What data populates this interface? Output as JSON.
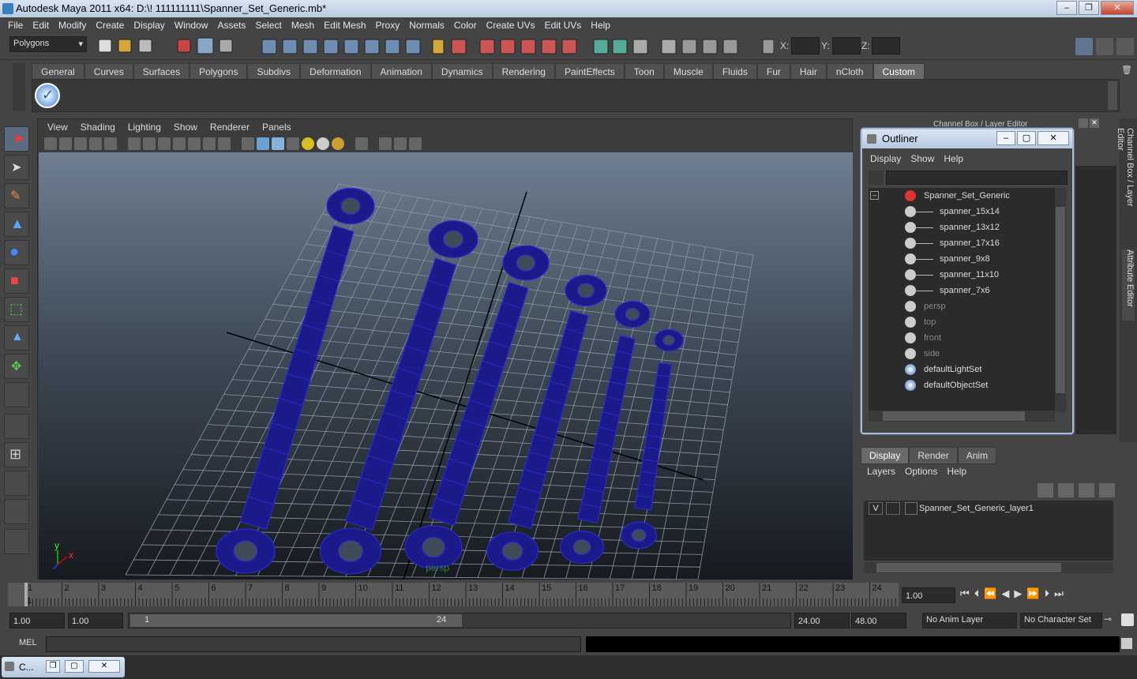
{
  "window": {
    "title": "Autodesk Maya 2011 x64: D:\\! 111111111\\Spanner_Set_Generic.mb*",
    "controls": [
      "–",
      "❐",
      "✕"
    ]
  },
  "menubar": [
    "File",
    "Edit",
    "Modify",
    "Create",
    "Display",
    "Window",
    "Assets",
    "Select",
    "Mesh",
    "Edit Mesh",
    "Proxy",
    "Normals",
    "Color",
    "Create UVs",
    "Edit UVs",
    "Help"
  ],
  "status": {
    "mode": "Polygons",
    "x_label": "X:",
    "y_label": "Y:",
    "z_label": "Z:"
  },
  "shelf_tabs": [
    "General",
    "Curves",
    "Surfaces",
    "Polygons",
    "Subdivs",
    "Deformation",
    "Animation",
    "Dynamics",
    "Rendering",
    "PaintEffects",
    "Toon",
    "Muscle",
    "Fluids",
    "Fur",
    "Hair",
    "nCloth",
    "Custom"
  ],
  "shelf_active": "Custom",
  "viewport": {
    "menu": [
      "View",
      "Shading",
      "Lighting",
      "Show",
      "Renderer",
      "Panels"
    ],
    "camera_label": "persp",
    "axis_y": "y",
    "axis_x": "x"
  },
  "channel_box_title": "Channel Box / Layer Editor",
  "side_tabs": {
    "channel": "Channel Box / Layer Editor",
    "attr": "Attribute Editor"
  },
  "outliner": {
    "title": "Outliner",
    "menu": [
      "Display",
      "Show",
      "Help"
    ],
    "items": [
      {
        "label": "Spanner_Set_Generic",
        "indent": 0,
        "dim": false,
        "expand": "–"
      },
      {
        "label": "spanner_15x14",
        "indent": 1,
        "dim": false
      },
      {
        "label": "spanner_13x12",
        "indent": 1,
        "dim": false
      },
      {
        "label": "spanner_17x16",
        "indent": 1,
        "dim": false
      },
      {
        "label": "spanner_9x8",
        "indent": 1,
        "dim": false
      },
      {
        "label": "spanner_11x10",
        "indent": 1,
        "dim": false
      },
      {
        "label": "spanner_7x6",
        "indent": 1,
        "dim": false
      },
      {
        "label": "persp",
        "indent": 0,
        "dim": true
      },
      {
        "label": "top",
        "indent": 0,
        "dim": true
      },
      {
        "label": "front",
        "indent": 0,
        "dim": true
      },
      {
        "label": "side",
        "indent": 0,
        "dim": true
      },
      {
        "label": "defaultLightSet",
        "indent": 0,
        "dim": false
      },
      {
        "label": "defaultObjectSet",
        "indent": 0,
        "dim": false
      }
    ]
  },
  "layers": {
    "tabs": [
      "Display",
      "Render",
      "Anim"
    ],
    "active": "Display",
    "menu": [
      "Layers",
      "Options",
      "Help"
    ],
    "row": {
      "visible": "V",
      "name": "Spanner_Set_Generic_layer1"
    }
  },
  "timeline": {
    "ticks": [
      "1",
      "2",
      "3",
      "4",
      "5",
      "6",
      "7",
      "8",
      "9",
      "10",
      "11",
      "12",
      "13",
      "14",
      "15",
      "16",
      "17",
      "18",
      "19",
      "20",
      "21",
      "22",
      "23",
      "24"
    ],
    "current": "1",
    "current_time": "1.00"
  },
  "range": {
    "start": "1.00",
    "start2": "1.00",
    "slider_start": "1",
    "slider_end": "24",
    "end": "24.00",
    "end2": "48.00",
    "anim_layer": "No Anim Layer",
    "char_set": "No Character Set"
  },
  "cmd": {
    "label": "MEL"
  },
  "taskbar": {
    "label": "C...",
    "controls": [
      "❐",
      "▢",
      "✕"
    ]
  }
}
